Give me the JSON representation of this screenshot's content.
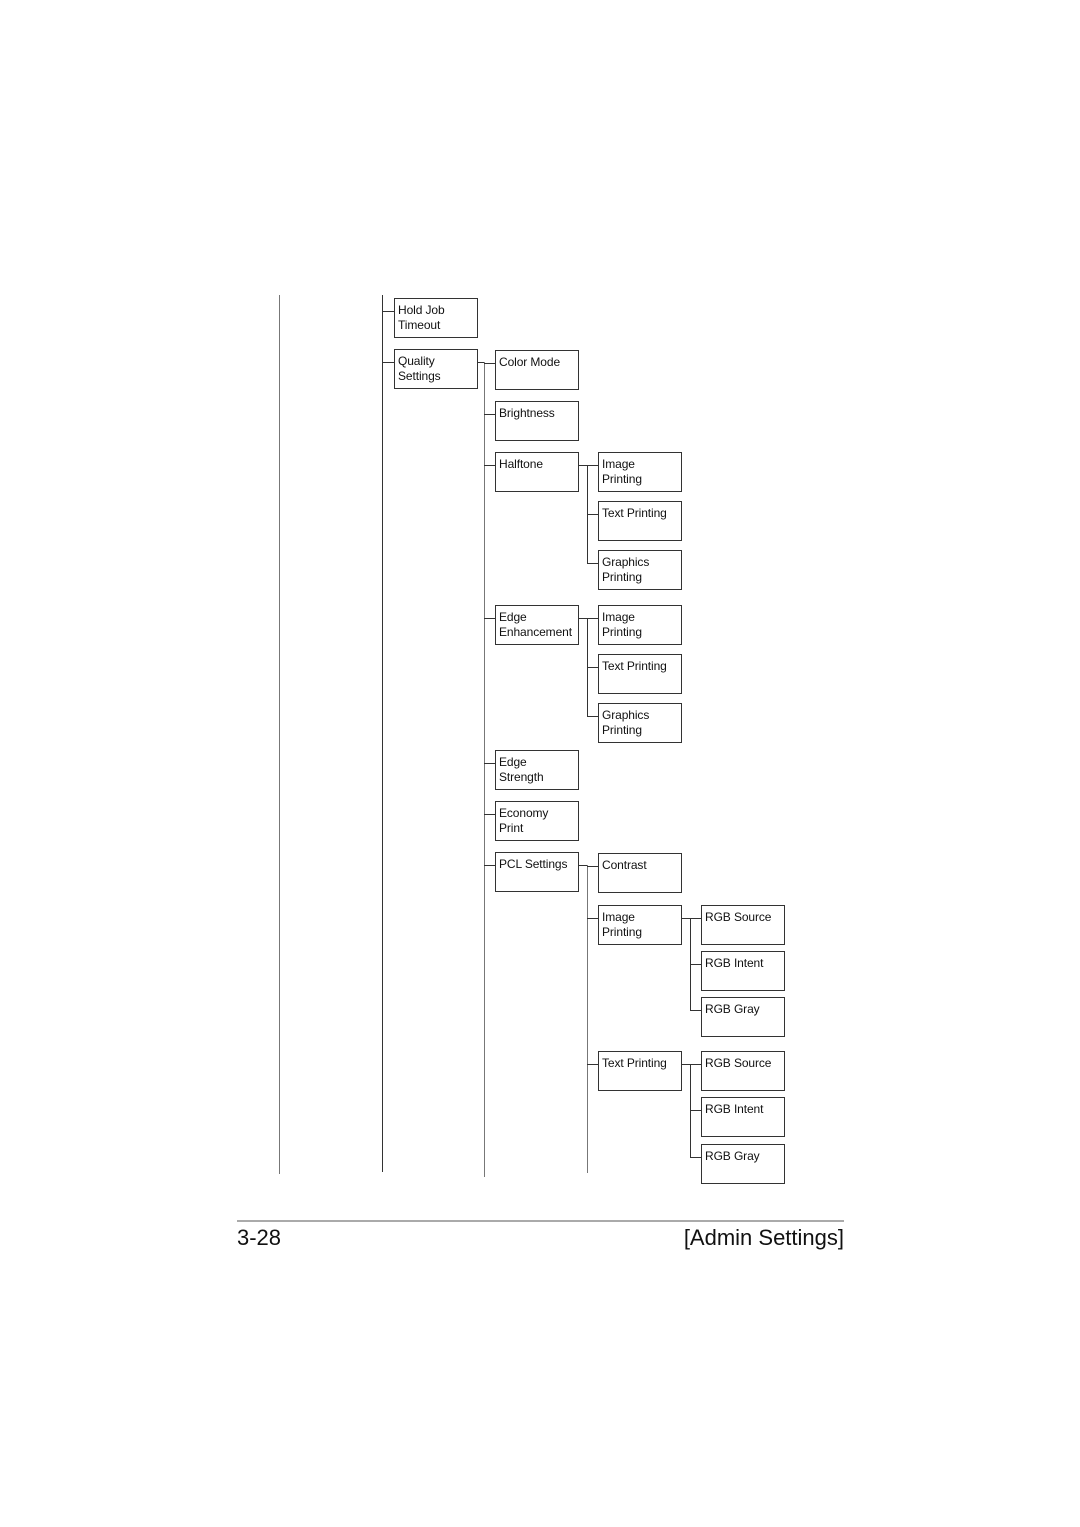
{
  "menu_tree": {
    "level1_items": [
      {
        "label": "Hold Job\nTimeout",
        "children": []
      },
      {
        "label": "Quality\nSettings",
        "children": [
          {
            "label": "Color Mode",
            "children": []
          },
          {
            "label": "Brightness",
            "children": []
          },
          {
            "label": "Halftone",
            "children": [
              {
                "label": "Image\nPrinting",
                "children": []
              },
              {
                "label": "Text Printing",
                "children": []
              },
              {
                "label": "Graphics\nPrinting",
                "children": []
              }
            ]
          },
          {
            "label": "Edge\nEnhancement",
            "children": [
              {
                "label": "Image\nPrinting",
                "children": []
              },
              {
                "label": "Text Printing",
                "children": []
              },
              {
                "label": "Graphics\nPrinting",
                "children": []
              }
            ]
          },
          {
            "label": "Edge\nStrength",
            "children": []
          },
          {
            "label": "Economy\nPrint",
            "children": []
          },
          {
            "label": "PCL Settings",
            "children": [
              {
                "label": "Contrast",
                "children": []
              },
              {
                "label": "Image\nPrinting",
                "children": [
                  {
                    "label": "RGB Source",
                    "children": []
                  },
                  {
                    "label": "RGB Intent",
                    "children": []
                  },
                  {
                    "label": "RGB Gray",
                    "children": []
                  }
                ]
              },
              {
                "label": "Text Printing",
                "children": [
                  {
                    "label": "RGB Source",
                    "children": []
                  },
                  {
                    "label": "RGB Intent",
                    "children": []
                  },
                  {
                    "label": "RGB Gray",
                    "children": []
                  }
                ]
              }
            ]
          }
        ]
      }
    ]
  },
  "footer": {
    "page_number": "3-28",
    "section_title": "[Admin Settings]"
  }
}
